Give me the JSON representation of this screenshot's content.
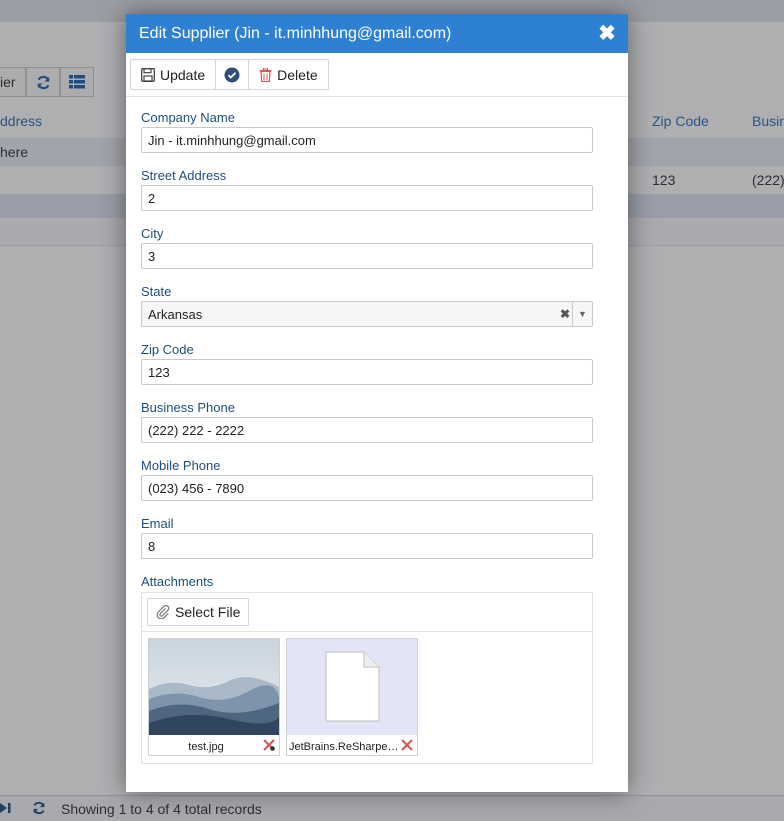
{
  "background": {
    "toolbar_label": "ier",
    "columns": {
      "address": "ddress",
      "zip": "Zip Code",
      "business": "Busin"
    },
    "row1": {
      "address": "here"
    },
    "row2": {
      "zip": "123",
      "business": "(222)"
    },
    "footer_text": "Showing 1 to 4 of 4 total records"
  },
  "dialog": {
    "title": "Edit Supplier (Jin - it.minhhung@gmail.com)",
    "toolbar": {
      "update_label": "Update",
      "delete_label": "Delete"
    },
    "fields": {
      "company_name": {
        "label": "Company Name",
        "value": "Jin - it.minhhung@gmail.com"
      },
      "street_address": {
        "label": "Street Address",
        "value": "2"
      },
      "city": {
        "label": "City",
        "value": "3"
      },
      "state": {
        "label": "State",
        "value": "Arkansas"
      },
      "zip_code": {
        "label": "Zip Code",
        "value": "123"
      },
      "business_phone": {
        "label": "Business Phone",
        "value": "(222) 222 - 2222"
      },
      "mobile_phone": {
        "label": "Mobile Phone",
        "value": "(023) 456 - 7890"
      },
      "email": {
        "label": "Email",
        "value": "8"
      }
    },
    "attachments": {
      "label": "Attachments",
      "select_file_label": "Select File",
      "files": [
        {
          "name": "test.jpg"
        },
        {
          "name": "JetBrains.ReSharper..."
        }
      ]
    }
  },
  "colors": {
    "title_bar": "#2e80d2",
    "link": "#2a6db0",
    "label": "#1f4e7a",
    "delete": "#d9534f"
  }
}
